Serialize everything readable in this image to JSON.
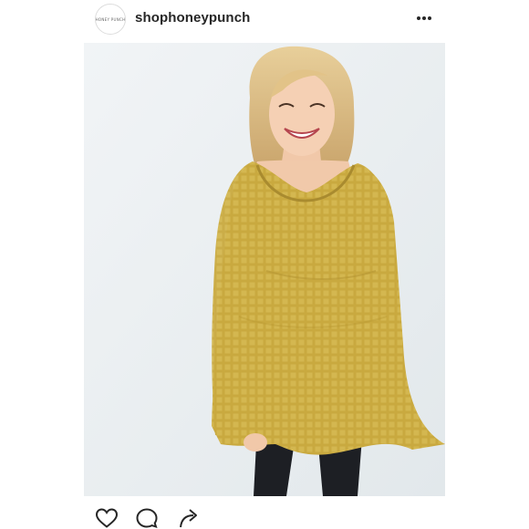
{
  "post": {
    "avatar_text": "HONEY PUNCH",
    "username": "shophoneypunch"
  },
  "icons": {
    "more": "more-horizontal-icon",
    "like": "heart-icon",
    "comment": "comment-icon",
    "share": "share-arrow-icon"
  },
  "colors": {
    "text": "#262626",
    "sweater": "#c6a63d",
    "background_wall": "#eaeff1"
  }
}
